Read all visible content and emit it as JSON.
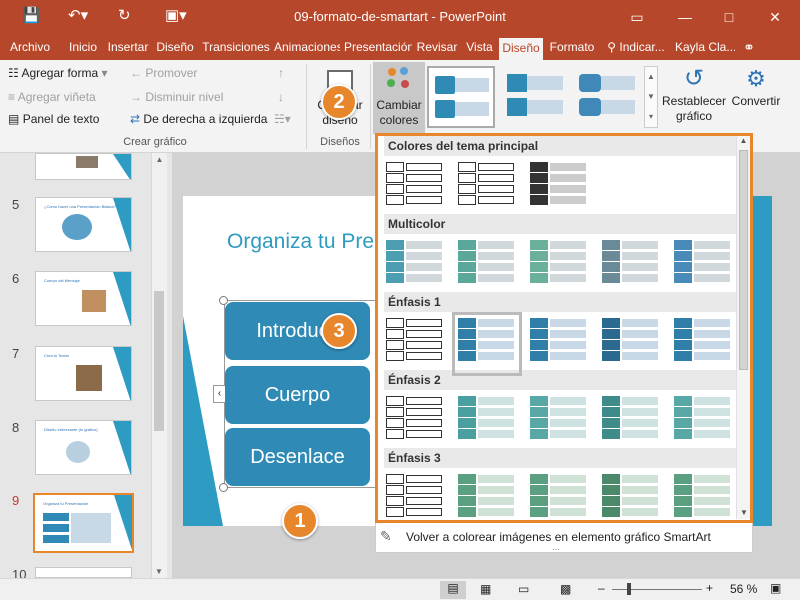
{
  "titlebar": {
    "document_title": "09-formato-de-smartart - PowerPoint",
    "save_icon": "save-icon",
    "undo_icon": "undo-icon",
    "redo_icon": "repeat-icon",
    "start_icon": "slideshow-icon"
  },
  "tabs": [
    "Archivo",
    "Inicio",
    "Insertar",
    "Diseño",
    "Transiciones",
    "Animaciones",
    "Presentación",
    "Revisar",
    "Vista",
    "Diseño",
    "Formato",
    "Indicar...",
    "Kayla Cla..."
  ],
  "selected_tab": "Diseño",
  "ribbon": {
    "crear_grafico": {
      "add_shape": "Agregar forma",
      "add_bullet": "Agregar viñeta",
      "text_pane": "Panel de texto",
      "promote": "Promover",
      "demote": "Disminuir nivel",
      "rtl": "De derecha a izquierda",
      "label": "Crear gráfico"
    },
    "disenos": {
      "change_layout": "Cambiar diseño",
      "label": "Diseños"
    },
    "cambiar_colores": "Cambiar colores",
    "restablecer": "Restablecer gráfico",
    "convertir": "Convertir"
  },
  "thumbnails": [
    {
      "num": "",
      "title": ""
    },
    {
      "num": "5",
      "title": "¿Cómo hacer una Presentación Básica?"
    },
    {
      "num": "6",
      "title": "Cuerpo del Mensaje"
    },
    {
      "num": "7",
      "title": "Crea tu Teatro"
    },
    {
      "num": "8",
      "title": "Diseño interesante (tu gráfico)"
    },
    {
      "num": "9",
      "title": "Organiza tu Presentación"
    },
    {
      "num": "10",
      "title": ""
    }
  ],
  "slide": {
    "title": "Organiza tu Pre",
    "boxes": [
      "Introducc",
      "Cuerpo",
      "Desenlace"
    ]
  },
  "callouts": [
    "1",
    "2",
    "3"
  ],
  "gallery": {
    "sections": [
      "Colores del tema principal",
      "Multicolor",
      "Énfasis 1",
      "Énfasis 2",
      "Énfasis 3"
    ],
    "recolor": "Volver a colorear imágenes en elemento gráfico SmartArt"
  },
  "status": {
    "zoom": "56 %"
  },
  "colors": {
    "accent": "#b7472a",
    "callout": "#e8862c",
    "smartart": "#2f8ab6"
  }
}
